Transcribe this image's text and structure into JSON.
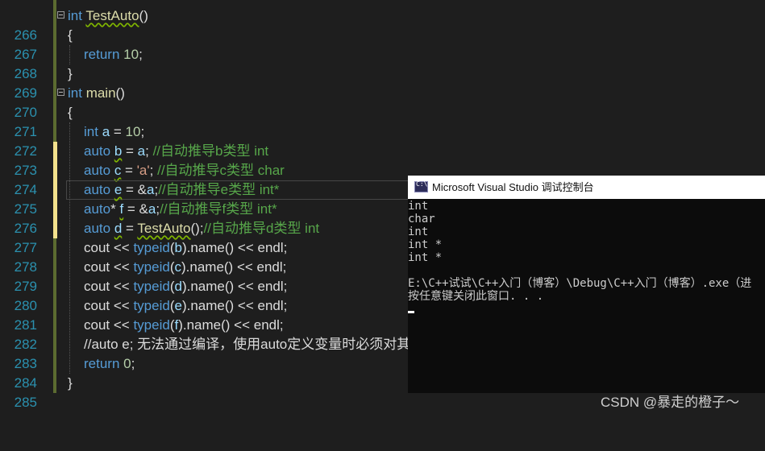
{
  "editor": {
    "lines": [
      {
        "num": "266",
        "code": "int TestAuto()"
      },
      {
        "num": "267",
        "code": "{"
      },
      {
        "num": "268",
        "code": "return 10;"
      },
      {
        "num": "269",
        "code": "}"
      },
      {
        "num": "270",
        "code": "int main()"
      },
      {
        "num": "271",
        "code": "{"
      },
      {
        "num": "272",
        "code": "int a = 10;"
      },
      {
        "num": "273",
        "code": "auto b = a; //自动推导b类型 int"
      },
      {
        "num": "274",
        "code": "auto c = 'a'; //自动推导c类型 char"
      },
      {
        "num": "275",
        "code": "auto e = &a;//自动推导e类型 int*"
      },
      {
        "num": "276",
        "code": "auto* f = &a;//自动推导f类型 int*"
      },
      {
        "num": "277",
        "code": "auto d = TestAuto();//自动推导d类型 int"
      },
      {
        "num": "278",
        "code": "cout << typeid(b).name() << endl;"
      },
      {
        "num": "279",
        "code": "cout << typeid(c).name() << endl;"
      },
      {
        "num": "280",
        "code": "cout << typeid(d).name() << endl;"
      },
      {
        "num": "281",
        "code": "cout << typeid(e).name() << endl;"
      },
      {
        "num": "282",
        "code": "cout << typeid(f).name() << endl;"
      },
      {
        "num": "283",
        "code": "//auto e; 无法通过编译，使用auto定义变量时必须对其进行初始化"
      },
      {
        "num": "284",
        "code": "return 0;"
      },
      {
        "num": "285",
        "code": "}"
      }
    ]
  },
  "console": {
    "title": "Microsoft Visual Studio 调试控制台",
    "icon": "console-app-icon",
    "icon_label": "C:\\",
    "output": [
      "int",
      "char",
      "int",
      "int *",
      "int *",
      "",
      "E:\\C++试试\\C++入门（博客）\\Debug\\C++入门（博客）.exe（进",
      "按任意键关闭此窗口. . ."
    ]
  },
  "watermark": "CSDN @暴走的橙子～"
}
